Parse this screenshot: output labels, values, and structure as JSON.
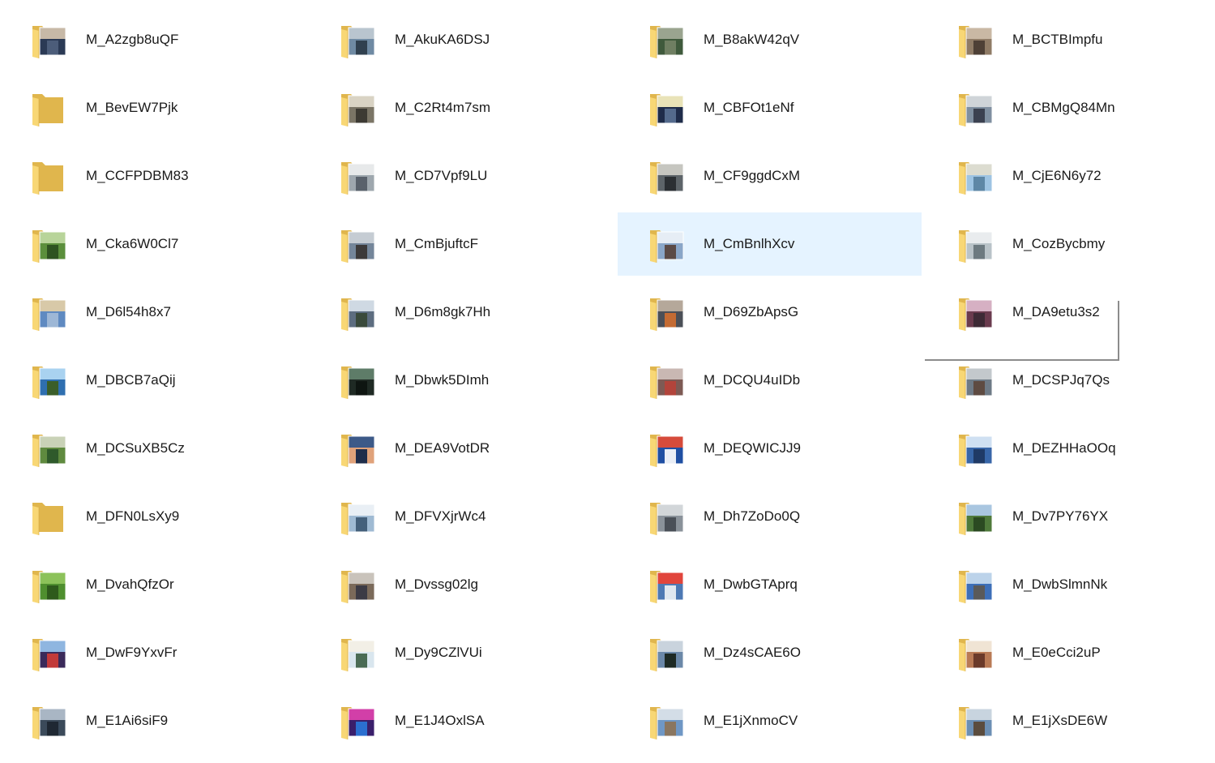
{
  "folders": [
    {
      "name": "M_A2zgb8uQF",
      "thumb": [
        "#2b3a55",
        "#c7b9a7",
        "#4c5d7a"
      ]
    },
    {
      "name": "M_AkuKA6DSJ",
      "thumb": [
        "#6f8aa3",
        "#b9c5cf",
        "#30404f"
      ]
    },
    {
      "name": "M_B8akW42qV",
      "thumb": [
        "#3f5a3c",
        "#9aa48f",
        "#6f7f62"
      ]
    },
    {
      "name": "M_BCTBImpfu",
      "thumb": [
        "#8f7b66",
        "#c9b8a4",
        "#4e4036"
      ]
    },
    {
      "name": "M_BevEW7Pjk",
      "thumb": null
    },
    {
      "name": "M_C2Rt4m7sm",
      "thumb": [
        "#7b7566",
        "#d9d3c4",
        "#3d3a33"
      ]
    },
    {
      "name": "M_CBFOt1eNf",
      "thumb": [
        "#1f2c4a",
        "#e9e3b8",
        "#546a8c"
      ]
    },
    {
      "name": "M_CBMgQ84Mn",
      "thumb": [
        "#7f8fa0",
        "#cfd4d8",
        "#3b4150"
      ]
    },
    {
      "name": "M_CCFPDBM83",
      "thumb": null
    },
    {
      "name": "M_CD7Vpf9LU",
      "thumb": [
        "#9ea7ae",
        "#e7e9ea",
        "#59616b"
      ]
    },
    {
      "name": "M_CF9ggdCxM",
      "thumb": [
        "#5d6469",
        "#c6c6c0",
        "#2b2f33"
      ]
    },
    {
      "name": "M_CjE6N6y72",
      "thumb": [
        "#9ec4e3",
        "#dcdcd0",
        "#5e87a6"
      ]
    },
    {
      "name": "M_Cka6W0Cl7",
      "thumb": [
        "#5b8f3c",
        "#b8d49a",
        "#2e5321"
      ]
    },
    {
      "name": "M_CmBjuftcF",
      "thumb": [
        "#74869a",
        "#c5ccd3",
        "#3c3a3a"
      ]
    },
    {
      "name": "M_CmBnlhXcv",
      "thumb": [
        "#8aa6c8",
        "#e6edf5",
        "#5b4a46"
      ]
    },
    {
      "name": "M_CozBycbmy",
      "thumb": [
        "#b9c3c8",
        "#e9ecee",
        "#6d7a80"
      ]
    },
    {
      "name": "M_D6l54h8x7",
      "thumb": [
        "#5f8ac1",
        "#d8c9a8",
        "#9db7d6"
      ]
    },
    {
      "name": "M_D6m8gk7Hh",
      "thumb": [
        "#5d6d80",
        "#cfd9e3",
        "#3a4a3b"
      ]
    },
    {
      "name": "M_D69ZbApsG",
      "thumb": [
        "#4b4f57",
        "#b5a89a",
        "#c46b33"
      ]
    },
    {
      "name": "M_DA9etu3s2",
      "thumb": [
        "#6a3b4e",
        "#d6b0c3",
        "#3d2a35"
      ]
    },
    {
      "name": "M_DBCB7aQij",
      "thumb": [
        "#2f6fb0",
        "#a9d2f0",
        "#3b5e2a"
      ]
    },
    {
      "name": "M_Dbwk5DImh",
      "thumb": [
        "#1f2a24",
        "#5e7c68",
        "#0e1511"
      ]
    },
    {
      "name": "M_DCQU4uIDb",
      "thumb": [
        "#7d5a54",
        "#c9b8b3",
        "#b2443b"
      ]
    },
    {
      "name": "M_DCSPJq7Qs",
      "thumb": [
        "#6e7a86",
        "#c3c8cc",
        "#5e4b42"
      ]
    },
    {
      "name": "M_DCSuXB5Cz",
      "thumb": [
        "#5f8a3f",
        "#c9d2b7",
        "#2f5a2b"
      ]
    },
    {
      "name": "M_DEA9VotDR",
      "thumb": [
        "#e0a27a",
        "#3d5a88",
        "#1f2d4a"
      ]
    },
    {
      "name": "M_DEQWICJJ9",
      "thumb": [
        "#1f4fa3",
        "#d64b3b",
        "#e9eef6"
      ]
    },
    {
      "name": "M_DEZHHaOOq",
      "thumb": [
        "#3866a8",
        "#cfe0f2",
        "#1f3a66"
      ]
    },
    {
      "name": "M_DFN0LsXy9",
      "thumb": null
    },
    {
      "name": "M_DFVXjrWc4",
      "thumb": [
        "#9fbad3",
        "#e9eff5",
        "#44607b"
      ]
    },
    {
      "name": "M_Dh7ZoDo0Q",
      "thumb": [
        "#8a929a",
        "#d2d6d9",
        "#4a5058"
      ]
    },
    {
      "name": "M_Dv7PY76YX",
      "thumb": [
        "#4f7a3b",
        "#a9c6e0",
        "#2b4a22"
      ]
    },
    {
      "name": "M_DvahQfzOr",
      "thumb": [
        "#4f8f2f",
        "#8cc25a",
        "#2e5a1c"
      ]
    },
    {
      "name": "M_Dvssg02lg",
      "thumb": [
        "#7b6a5a",
        "#c9c3bb",
        "#3c3b45"
      ]
    },
    {
      "name": "M_DwbGTAprq",
      "thumb": [
        "#4d79b4",
        "#e1453c",
        "#dfe7f0"
      ]
    },
    {
      "name": "M_DwbSlmnNk",
      "thumb": [
        "#3d6fb8",
        "#bcd3ea",
        "#5a5a5a"
      ]
    },
    {
      "name": "M_DwF9YxvFr",
      "thumb": [
        "#3a2a5a",
        "#8fb6e0",
        "#c23a3a"
      ]
    },
    {
      "name": "M_Dy9CZlVUi",
      "thumb": [
        "#d9e6ee",
        "#f2efe6",
        "#4a6b54"
      ]
    },
    {
      "name": "M_Dz4sCAE6O",
      "thumb": [
        "#6b88a8",
        "#c9d3dd",
        "#1e2a24"
      ]
    },
    {
      "name": "M_E0eCci2uP",
      "thumb": [
        "#b97a55",
        "#f0e4d4",
        "#6b3a2a"
      ]
    },
    {
      "name": "M_E1Ai6siF9",
      "thumb": [
        "#3b4a5a",
        "#a9b6c4",
        "#1f2833"
      ]
    },
    {
      "name": "M_E1J4OxlSA",
      "thumb": [
        "#3a1f6b",
        "#d23fa8",
        "#2b6fd0"
      ]
    },
    {
      "name": "M_E1jXnmoCV",
      "thumb": [
        "#6f97c5",
        "#d3dde7",
        "#8a7660"
      ]
    },
    {
      "name": "M_E1jXsDE6W",
      "thumb": [
        "#6c8fb4",
        "#c8d4df",
        "#5b4c3e"
      ]
    }
  ],
  "selected_index": 14,
  "colors": {
    "selection_bg": "#e5f3ff",
    "folder_back": "#e0b64d",
    "folder_front": "#f8d775",
    "text": "#1a1a1a"
  }
}
